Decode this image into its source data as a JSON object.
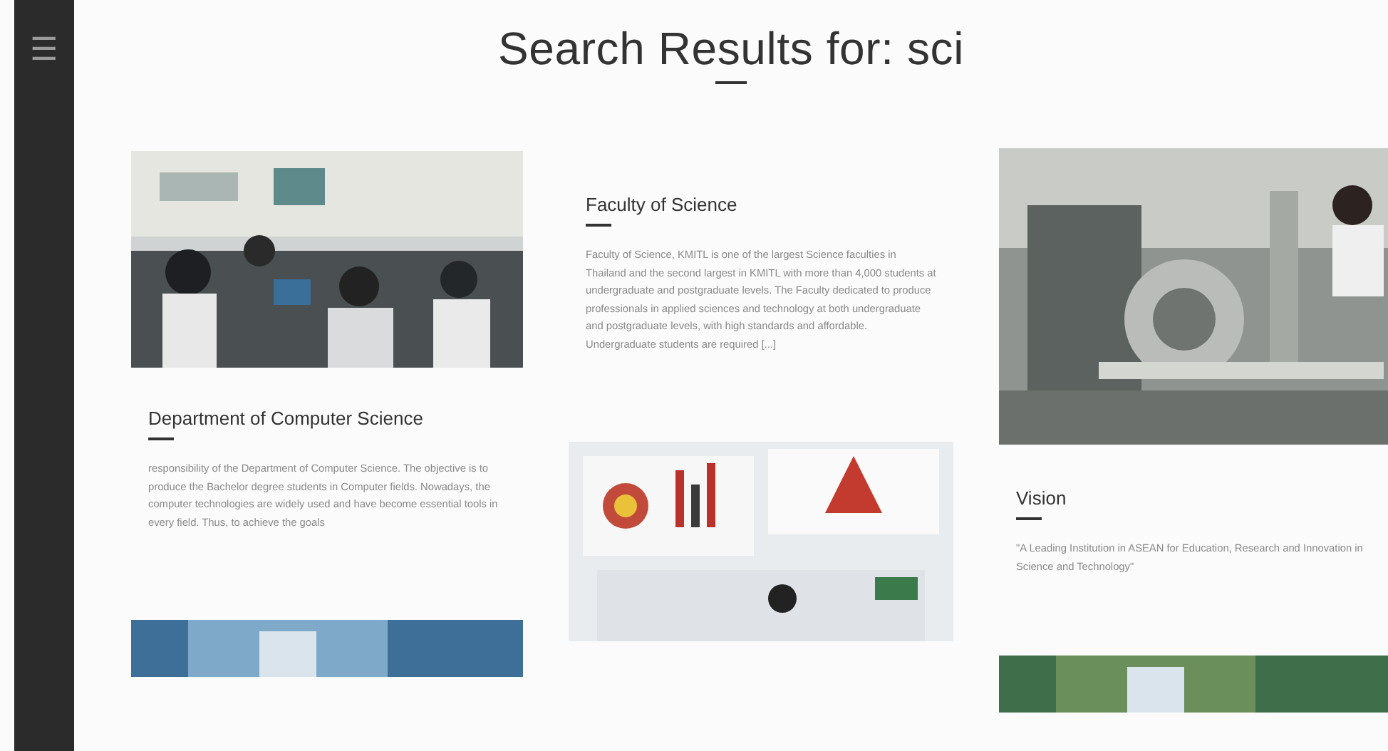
{
  "menu": {
    "icon": "☰"
  },
  "heading": "Search Results for: sci",
  "columns": [
    [
      {
        "kind": "picture"
      },
      {
        "kind": "text",
        "title": "Department of Computer Science",
        "body": "responsibility of the Department of Computer Science. The objective is to produce the Bachelor degree students in Computer fields. Nowadays, the computer technologies are widely used and have become essential tools in every field. Thus, to achieve the goals"
      },
      {
        "kind": "picture"
      }
    ],
    [
      {
        "kind": "text",
        "title": "Faculty of Science",
        "body": "Faculty of Science, KMITL is one of the largest Science faculties in Thailand and the second largest in KMITL with more than 4,000 students at undergraduate and postgraduate levels. The Faculty dedicated to produce professionals in applied sciences and technology at both undergraduate and postgraduate levels, with high standards and affordable. Undergraduate students are required [...]"
      },
      {
        "kind": "picture"
      }
    ],
    [
      {
        "kind": "picture"
      },
      {
        "kind": "text",
        "title": "Vision",
        "body": "\"A Leading Institution in ASEAN for Education, Research and Innovation in Science and Technology\""
      },
      {
        "kind": "picture"
      }
    ]
  ]
}
